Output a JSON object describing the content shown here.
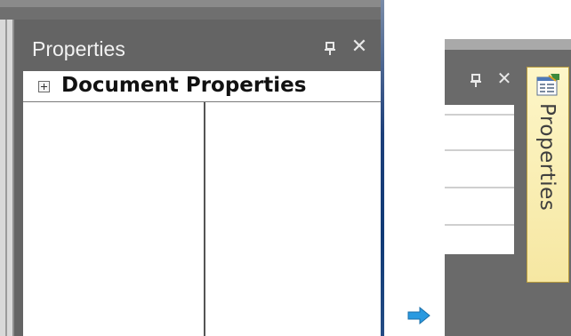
{
  "panel": {
    "title": "Properties",
    "category_label": "Document Properties",
    "pin_icon": "pin-icon",
    "close_icon": "close-icon",
    "close_glyph": "✕",
    "expand_icon": "plus-box-icon"
  },
  "autohide": {
    "tab_label": "Properties",
    "tab_icon": "properties-window-icon",
    "close_glyph": "✕"
  },
  "arrow_icon": "arrow-right-icon",
  "colors": {
    "panel_bg": "#646464",
    "tab_bg": "#f6e7a2",
    "arrow": "#2a9ae0"
  }
}
